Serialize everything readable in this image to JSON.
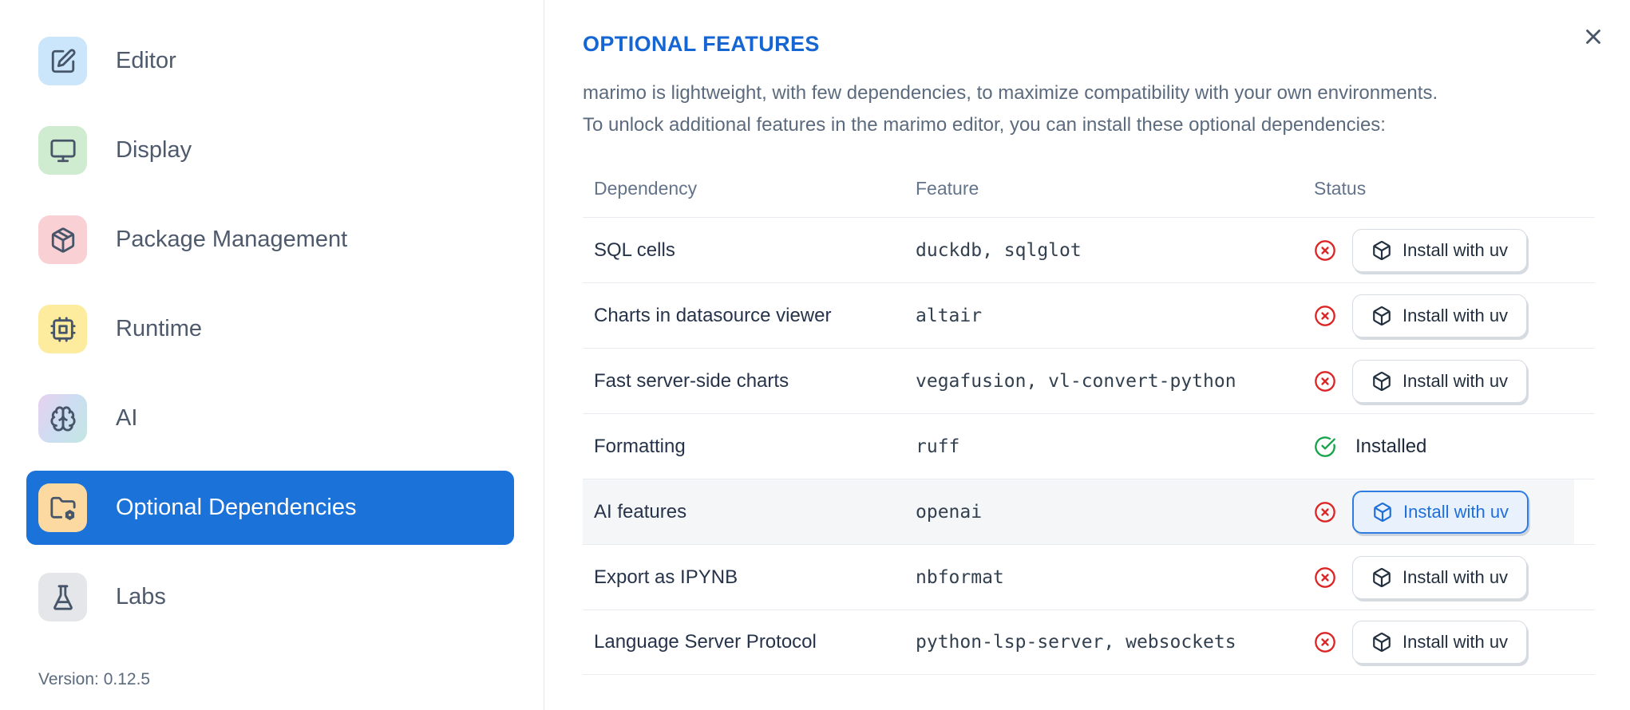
{
  "window": {
    "close_icon": "x-icon"
  },
  "sidebar": {
    "items": [
      {
        "label": "Editor",
        "icon": "edit-icon",
        "selected": false
      },
      {
        "label": "Display",
        "icon": "monitor-icon",
        "selected": false
      },
      {
        "label": "Package Management",
        "icon": "package-icon",
        "selected": false
      },
      {
        "label": "Runtime",
        "icon": "cpu-icon",
        "selected": false
      },
      {
        "label": "AI",
        "icon": "brain-icon",
        "selected": false
      },
      {
        "label": "Optional Dependencies",
        "icon": "folder-cog-icon",
        "selected": true
      },
      {
        "label": "Labs",
        "icon": "flask-icon",
        "selected": false
      }
    ],
    "version_label": "Version: 0.12.5"
  },
  "main": {
    "title": "OPTIONAL FEATURES",
    "description_line1": "marimo is lightweight, with few dependencies, to maximize compatibility with your own environments.",
    "description_line2": "To unlock additional features in the marimo editor, you can install these optional dependencies:",
    "table": {
      "headers": [
        "Dependency",
        "Feature",
        "Status"
      ],
      "install_button_icon": "box-icon",
      "rows": [
        {
          "dependency": "SQL cells",
          "feature": "duckdb, sqlglot",
          "installed": false,
          "action": "Install with uv",
          "highlighted": false
        },
        {
          "dependency": "Charts in datasource viewer",
          "feature": "altair",
          "installed": false,
          "action": "Install with uv",
          "highlighted": false
        },
        {
          "dependency": "Fast server-side charts",
          "feature": "vegafusion, vl-convert-python",
          "installed": false,
          "action": "Install with uv",
          "highlighted": false
        },
        {
          "dependency": "Formatting",
          "feature": "ruff",
          "installed": true,
          "status_label": "Installed",
          "highlighted": false
        },
        {
          "dependency": "AI features",
          "feature": "openai",
          "installed": false,
          "action": "Install with uv",
          "highlighted": true
        },
        {
          "dependency": "Export as IPYNB",
          "feature": "nbformat",
          "installed": false,
          "action": "Install with uv",
          "highlighted": false
        },
        {
          "dependency": "Language Server Protocol",
          "feature": "python-lsp-server, websockets",
          "installed": false,
          "action": "Install with uv",
          "highlighted": false
        }
      ]
    }
  },
  "colors": {
    "accent_blue": "#1b72d8",
    "heading_blue": "#1565d2",
    "error_red": "#dc2626",
    "success_green": "#16a34a",
    "highlight_button_blue": "#2e7ce2"
  }
}
